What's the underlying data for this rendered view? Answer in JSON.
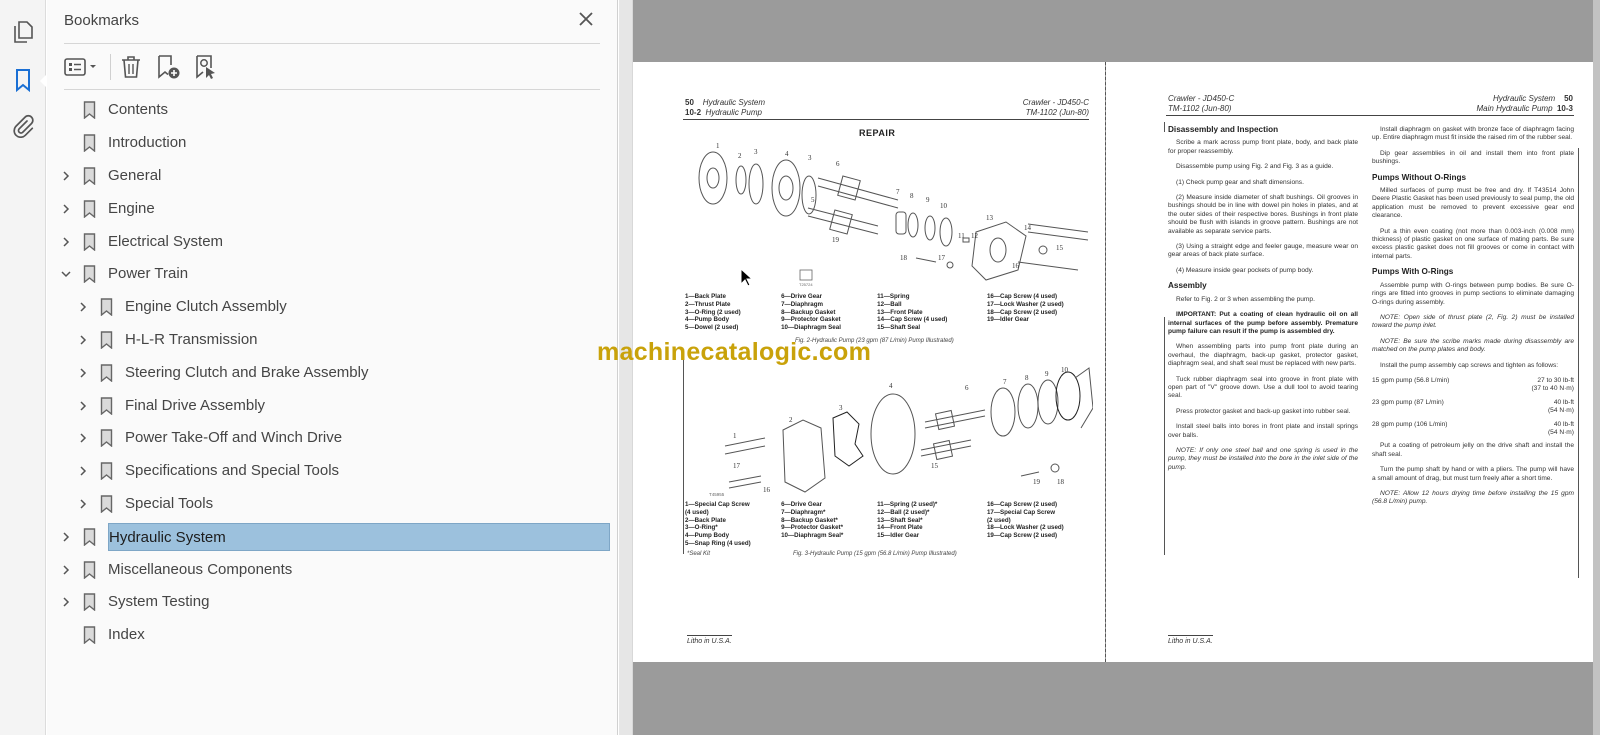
{
  "rail": {
    "items": [
      {
        "name": "page-thumbnails",
        "icon": "pages-icon"
      },
      {
        "name": "bookmarks",
        "icon": "bookmark-icon",
        "active": true
      },
      {
        "name": "attachments",
        "icon": "paperclip-icon"
      }
    ]
  },
  "bookmarks_panel": {
    "title": "Bookmarks",
    "close_icon": "close-icon",
    "toolbar": {
      "options": "options-menu-icon",
      "delete": "trash-icon",
      "add_new": "add-bookmark-icon",
      "find_current": "find-current-bookmark-icon"
    },
    "items": [
      {
        "label": "Contents",
        "level": 0,
        "expander": "none"
      },
      {
        "label": "Introduction",
        "level": 0,
        "expander": "none"
      },
      {
        "label": "General",
        "level": 0,
        "expander": "collapsed"
      },
      {
        "label": "Engine",
        "level": 0,
        "expander": "collapsed"
      },
      {
        "label": "Electrical System",
        "level": 0,
        "expander": "collapsed"
      },
      {
        "label": "Power Train",
        "level": 0,
        "expander": "expanded"
      },
      {
        "label": "Engine Clutch  Assembly",
        "level": 1,
        "expander": "collapsed"
      },
      {
        "label": "H-L-R Transmission",
        "level": 1,
        "expander": "collapsed"
      },
      {
        "label": "Steering Clutch and Brake Assembly",
        "level": 1,
        "expander": "collapsed"
      },
      {
        "label": "Final Drive Assembly",
        "level": 1,
        "expander": "collapsed"
      },
      {
        "label": "Power Take-Off and Winch Drive",
        "level": 1,
        "expander": "collapsed"
      },
      {
        "label": "Specifications and Special Tools",
        "level": 1,
        "expander": "collapsed"
      },
      {
        "label": "Special Tools",
        "level": 1,
        "expander": "collapsed"
      },
      {
        "label": "Hydraulic System",
        "level": 0,
        "expander": "collapsed",
        "selected": true
      },
      {
        "label": "Miscellaneous Components",
        "level": 0,
        "expander": "collapsed"
      },
      {
        "label": "System Testing",
        "level": 0,
        "expander": "collapsed"
      },
      {
        "label": "Index",
        "level": 0,
        "expander": "none"
      }
    ]
  },
  "document": {
    "watermark": "machinecatalogic.com",
    "left_page": {
      "header": {
        "section_no": "50",
        "section": "Hydraulic System",
        "page_no": "10-2",
        "subsection": "Hydraulic Pump",
        "machine": "Crawler - JD450-C",
        "manual": "TM-1102   (Jun-80)"
      },
      "heading": "REPAIR",
      "fig2": {
        "legend": [
          [
            "1—Back Plate",
            "2—Thrust Plate",
            "3—O-Ring (2 used)",
            "4—Pump Body",
            "5—Dowel (2 used)"
          ],
          [
            "6—Drive Gear",
            "7—Diaphragm",
            "8—Backup Gasket",
            "9—Protector Gasket",
            "10—Diaphragm Seal"
          ],
          [
            "11—Spring",
            "12—Ball",
            "13—Front Plate",
            "14—Cap Screw (4 used)",
            "15—Shaft Seal"
          ],
          [
            "16—Cap Screw (4 used)",
            "17—Lock Washer (2 used)",
            "18—Cap Screw (2 used)",
            "19—Idler Gear"
          ]
        ],
        "caption": "Fig. 2-Hydraulic Pump (23 gpm (87 L/min) Pump Illustrated)"
      },
      "fig3": {
        "legend": [
          [
            "1—Special Cap Screw",
            "    (4 used)",
            "2—Back Plate",
            "3—O-Ring*",
            "4—Pump Body",
            "5—Snap Ring (4 used)"
          ],
          [
            "6—Drive Gear",
            "7—Diaphragm*",
            "8—Backup Gasket*",
            "9—Protector Gasket*",
            "10—Diaphragm Seal*"
          ],
          [
            "11—Spring (2 used)*",
            "12—Ball (2 used)*",
            "13—Shaft Seal*",
            "14—Front Plate",
            "15—Idler Gear"
          ],
          [
            "16—Cap Screw (2 used)",
            "17—Special Cap Screw",
            "    (2 used)",
            "18—Lock Washer (2 used)",
            "19—Cap Screw (2 used)"
          ]
        ],
        "footnote": "*Seal Kit",
        "caption": "Fig. 3-Hydraulic Pump (15 gpm (56.8 L/min) Pump Illustrated)"
      },
      "footer": "Litho in U.S.A."
    },
    "right_page": {
      "header": {
        "machine": "Crawler - JD450-C",
        "manual": "TM-1102   (Jun-80)",
        "section": "Hydraulic System",
        "section_no": "50",
        "subsection": "Main Hydraulic Pump",
        "page_no": "10-3"
      },
      "col1": {
        "h1": "Disassembly and Inspection",
        "p1": "Scribe a mark across pump front plate, body, and back plate for proper reassembly.",
        "p2": "Disassemble pump using Fig. 2 and Fig. 3 as a guide.",
        "s1": "(1) Check pump gear and shaft dimensions.",
        "s2": "(2) Measure inside diameter of shaft bushings. Oil grooves in bushings should be in line with dowel pin holes in plates, and at the outer sides of their respective bores. Bushings in front plate should be flush with islands in groove pattern. Bushings are not available as separate service parts.",
        "s3": "(3) Using a straight edge and feeler gauge, measure wear on gear areas of back plate surface.",
        "s4": "(4) Measure inside gear pockets of pump body.",
        "h2": "Assembly",
        "p3": "Refer to Fig. 2 or 3 when assembling the pump.",
        "important": "IMPORTANT: Put a coating of clean hydraulic oil on all internal surfaces of the pump before assembly. Premature pump failure can result if the pump is assembled dry.",
        "p4": "When assembling parts into pump front plate during an overhaul, the diaphragm, back-up gasket, protector gasket, diaphragm seal, and shaft seal must be replaced with new parts.",
        "p5": "Tuck rubber diaphragm seal into groove in front plate with open part of \"V\" groove down. Use a dull tool to avoid tearing seal.",
        "p6": "Press protector gasket and back-up gasket into rubber seal.",
        "p7": "Install steel balls into bores in front plate and install springs over balls.",
        "note1": "NOTE: If only one steel ball and one spring is used in the pump, they must be installed into the bore in the inlet side of the pump."
      },
      "col2": {
        "p1": "Install diaphragm on gasket with bronze face of diaphragm facing up. Entire diaphragm must fit inside the raised rim of the rubber seal.",
        "p2": "Dip gear assemblies in oil and install them into front plate bushings.",
        "h1": "Pumps Without O-Rings",
        "p3": "Milled surfaces of pump must be free and dry. If T43514 John Deere Plastic Gasket has been used previously to seal pump, the old application must be removed to prevent excessive gear end clearance.",
        "p4": "Put a thin even coating (not more than 0.003-inch (0.008 mm) thickness) of plastic gasket on one surface of mating parts. Be sure excess plastic gasket does not fill grooves or come in contact with internal parts.",
        "h2": "Pumps With O-Rings",
        "p5": "Assemble pump with O-rings between pump bodies. Be sure O-rings are fitted into grooves in pump sections to eliminate damaging O-rings during assembly.",
        "note1": "NOTE: Open side of thrust plate (2, Fig. 2) must be installed toward the pump inlet.",
        "note2": "NOTE: Be sure the scribe marks made during disassembly are matched on the pump plates and body.",
        "p6": "Install the pump assembly cap screws and tighten as follows:",
        "torques": [
          {
            "pump": "15 gpm pump (56.8 L/min)",
            "value": "27 to 30 lb-ft",
            "metric": "(37 to 40 N·m)"
          },
          {
            "pump": "23 gpm pump (87 L/min)",
            "value": "40 lb-ft",
            "metric": "(54 N·m)"
          },
          {
            "pump": "28 gpm pump (106 L/min)",
            "value": "40 lb-ft",
            "metric": "(54 N·m)"
          }
        ],
        "p7": "Put a coating of petroleum jelly on the drive shaft and install the shaft seal.",
        "p8": "Turn the pump shaft by hand or with a pliers. The pump will have a small amount of drag, but must turn freely after a short time.",
        "note3": "NOTE: Allow 12 hours drying time before installing the 15 gpm (56.8 L/min) pump."
      },
      "footer": "Litho in U.S.A."
    }
  }
}
